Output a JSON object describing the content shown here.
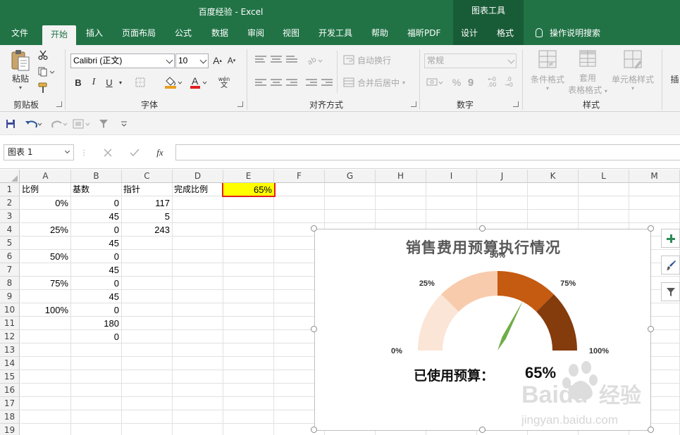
{
  "window": {
    "title": "百度经验  -  Excel",
    "context_tab": "图表工具"
  },
  "tabs": [
    "文件",
    "开始",
    "插入",
    "页面布局",
    "公式",
    "数据",
    "审阅",
    "视图",
    "开发工具",
    "帮助",
    "福昕PDF",
    "设计",
    "格式"
  ],
  "active_tab": "开始",
  "tell_me": "操作说明搜索",
  "ribbon": {
    "clipboard": {
      "paste": "粘贴",
      "label": "剪贴板"
    },
    "font": {
      "name": "Calibri (正文)",
      "size": "10",
      "label": "字体",
      "increase": "A",
      "decrease": "A",
      "bold": "B",
      "italic": "I",
      "underline": "U",
      "phonetic": "wén",
      "font_color_glyph": "A",
      "font_color": "#ff0000",
      "fill_color": "#ffff00"
    },
    "alignment": {
      "wrap_text": "自动换行",
      "merge_center": "合并后居中",
      "label": "对齐方式"
    },
    "number": {
      "format": "常规",
      "percent": "%",
      "comma": "9",
      "label": "数字",
      "inc_decimal": ".00",
      "dec_decimal": ".0"
    },
    "styles": {
      "conditional": "条件格式",
      "table_format_1": "套用",
      "table_format_2": "表格格式",
      "cell_styles": "单元格样式",
      "label": "样式",
      "insert_partial": "插"
    }
  },
  "name_box": "图表 1",
  "formula_icon": "fx",
  "columns": [
    "A",
    "B",
    "C",
    "D",
    "E",
    "F",
    "G",
    "H",
    "I",
    "J",
    "K",
    "L",
    "M"
  ],
  "rows": [
    "1",
    "2",
    "3",
    "4",
    "5",
    "6",
    "7",
    "8",
    "9",
    "10",
    "11",
    "12",
    "13",
    "14",
    "15",
    "16",
    "17",
    "18",
    "19"
  ],
  "sheet": {
    "headers": {
      "a1": "比例",
      "b1": "基数",
      "c1": "指针",
      "d1": "完成比例",
      "e1": "65%"
    },
    "col_a": [
      "0%",
      "",
      "25%",
      "",
      "50%",
      "",
      "75%",
      "",
      "100%",
      "",
      ""
    ],
    "col_b": [
      "0",
      "45",
      "0",
      "45",
      "0",
      "45",
      "0",
      "45",
      "0",
      "180",
      "0"
    ],
    "col_c": [
      "117",
      "5",
      "243"
    ],
    "highlight": "#ffff00",
    "highlight_border": "#e02020"
  },
  "chart": {
    "title": "销售费用预算执行情况",
    "footer_label": "已使用预算：",
    "footer_value": "65%",
    "tick_labels": [
      "0%",
      "25%",
      "50%",
      "75%",
      "100%"
    ],
    "colors": [
      "#fbe5d6",
      "#f8cbad",
      "#c55a11",
      "#843c0c"
    ],
    "needle_color": "#70ad47"
  },
  "chart_data": {
    "type": "gauge",
    "title": "销售费用预算执行情况",
    "categories": [
      "0%-25%",
      "25%-50%",
      "50%-75%",
      "75%-100%"
    ],
    "values": [
      45,
      45,
      45,
      45
    ],
    "pointer_value": 0.65,
    "tick_labels": [
      "0%",
      "25%",
      "50%",
      "75%",
      "100%"
    ]
  },
  "watermark": {
    "logo": "Baidu 经验",
    "url": "jingyan.baidu.com"
  }
}
